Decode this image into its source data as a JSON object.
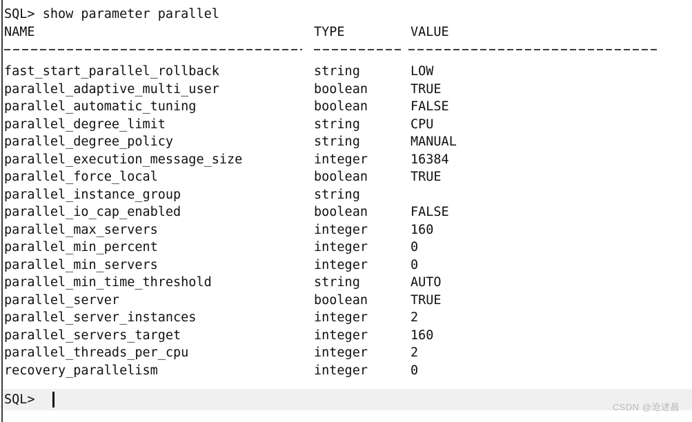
{
  "terminal": {
    "prompt": "SQL>",
    "command_line": "SQL> show parameter parallel",
    "bottom_prompt": "SQL>",
    "cursor": "|",
    "background": "#ffffff",
    "foreground": "#101010",
    "prompt_band_color": "#f0f0f0"
  },
  "table": {
    "headers": {
      "name": "NAME",
      "type": "TYPE",
      "value": "VALUE"
    },
    "rows": [
      {
        "name": "fast_start_parallel_rollback",
        "type": "string",
        "value": "LOW"
      },
      {
        "name": "parallel_adaptive_multi_user",
        "type": "boolean",
        "value": "TRUE"
      },
      {
        "name": "parallel_automatic_tuning",
        "type": "boolean",
        "value": "FALSE"
      },
      {
        "name": "parallel_degree_limit",
        "type": "string",
        "value": "CPU"
      },
      {
        "name": "parallel_degree_policy",
        "type": "string",
        "value": "MANUAL"
      },
      {
        "name": "parallel_execution_message_size",
        "type": "integer",
        "value": "16384"
      },
      {
        "name": "parallel_force_local",
        "type": "boolean",
        "value": "TRUE"
      },
      {
        "name": "parallel_instance_group",
        "type": "string",
        "value": ""
      },
      {
        "name": "parallel_io_cap_enabled",
        "type": "boolean",
        "value": "FALSE"
      },
      {
        "name": "parallel_max_servers",
        "type": "integer",
        "value": "160"
      },
      {
        "name": "parallel_min_percent",
        "type": "integer",
        "value": "0"
      },
      {
        "name": "parallel_min_servers",
        "type": "integer",
        "value": "0"
      },
      {
        "name": "parallel_min_time_threshold",
        "type": "string",
        "value": "AUTO"
      },
      {
        "name": "parallel_server",
        "type": "boolean",
        "value": "TRUE"
      },
      {
        "name": "parallel_server_instances",
        "type": "integer",
        "value": "2"
      },
      {
        "name": "parallel_servers_target",
        "type": "integer",
        "value": "160"
      },
      {
        "name": "parallel_threads_per_cpu",
        "type": "integer",
        "value": "2"
      },
      {
        "name": "recovery_parallelism",
        "type": "integer",
        "value": "0"
      }
    ]
  },
  "watermark": {
    "text": "CSDN @沧述昌"
  }
}
